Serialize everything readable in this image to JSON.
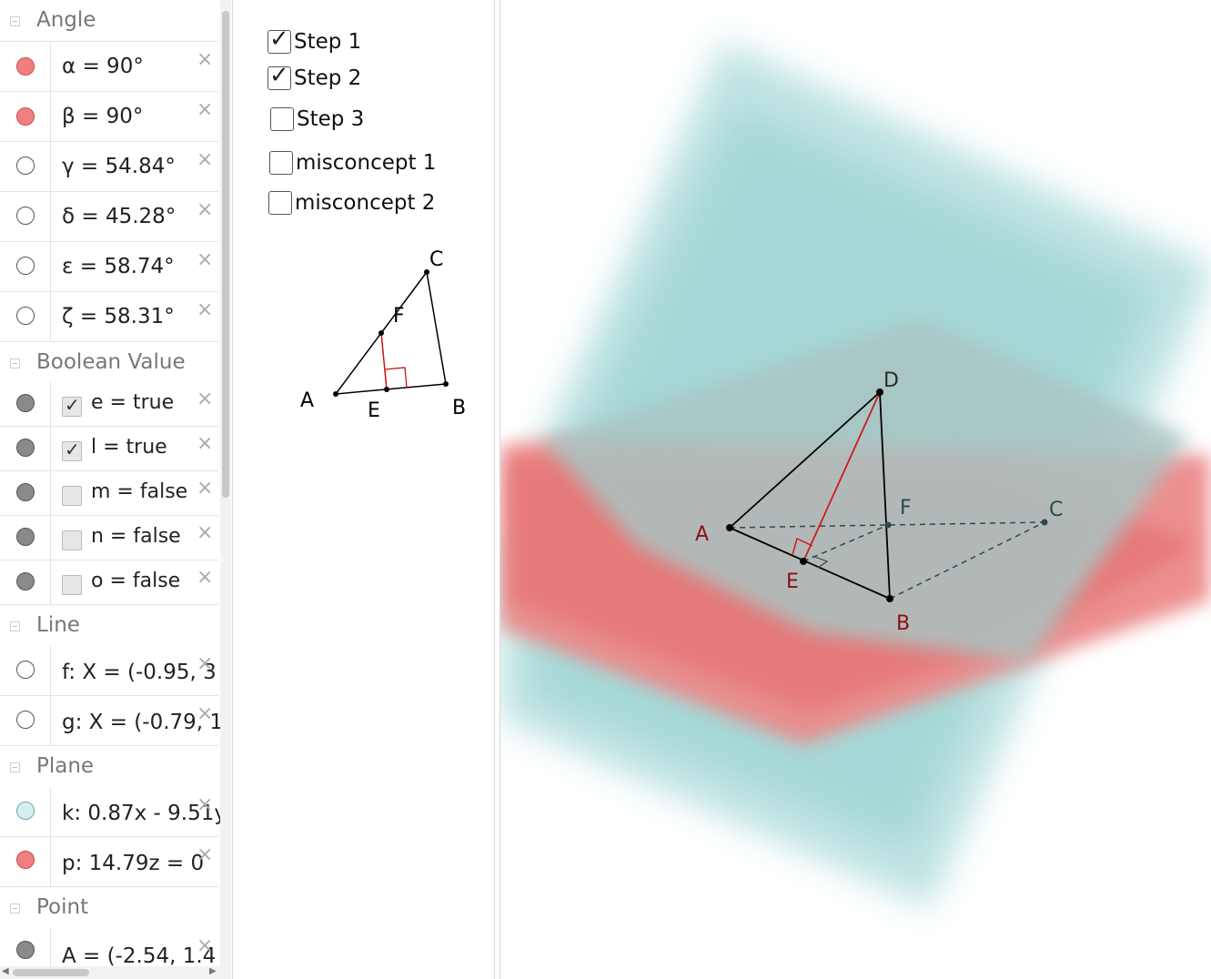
{
  "algebra": {
    "groups": [
      {
        "title": "Angle",
        "rows": [
          {
            "expr": "α = 90°",
            "dot": "red"
          },
          {
            "expr": "β = 90°",
            "dot": "red"
          },
          {
            "expr": "γ = 54.84°",
            "dot": "hidden"
          },
          {
            "expr": "δ = 45.28°",
            "dot": "hidden"
          },
          {
            "expr": "ε = 58.74°",
            "dot": "hidden"
          },
          {
            "expr": "ζ = 58.31°",
            "dot": "hidden"
          }
        ]
      },
      {
        "title": "Boolean Value",
        "rows": [
          {
            "expr": "e = true",
            "dot": "gray",
            "checked": true
          },
          {
            "expr": "l = true",
            "dot": "gray",
            "checked": true
          },
          {
            "expr": "m = false",
            "dot": "gray",
            "checked": false
          },
          {
            "expr": "n = false",
            "dot": "gray",
            "checked": false
          },
          {
            "expr": "o = false",
            "dot": "gray",
            "checked": false
          }
        ]
      },
      {
        "title": "Line",
        "rows": [
          {
            "expr": "f: X = (-0.95, 3",
            "dot": "hidden"
          },
          {
            "expr": "g: X = (-0.79, 1",
            "dot": "hidden"
          }
        ]
      },
      {
        "title": "Plane",
        "rows": [
          {
            "expr": "k: 0.87x - 9.51y",
            "dot": "teal"
          },
          {
            "expr": "p: 14.79z = 0",
            "dot": "red"
          }
        ]
      },
      {
        "title": "Point",
        "rows": [
          {
            "expr": "A = (-2.54, 1.4",
            "dot": "gray"
          }
        ]
      }
    ],
    "close_glyph": "×"
  },
  "graphics2d": {
    "checkboxes": [
      {
        "label": "Step 1",
        "checked": true
      },
      {
        "label": "Step 2",
        "checked": true
      },
      {
        "label": "Step 3",
        "checked": false
      },
      {
        "label": "misconcept 1",
        "checked": false
      },
      {
        "label": "misconcept 2",
        "checked": false
      }
    ],
    "check_glyph": "✓",
    "triangle_labels": {
      "A": "A",
      "B": "B",
      "C": "C",
      "E": "E",
      "F": "F"
    }
  },
  "graphics3d": {
    "point_labels": {
      "A": "A",
      "B": "B",
      "C": "C",
      "D": "D",
      "E": "E",
      "F": "F"
    },
    "colors": {
      "plane_k": "#99d3d1",
      "plane_p": "#e86a6a",
      "altitude": "#d11a1a",
      "edges": "#000000",
      "hidden_edges": "#2b4a48"
    }
  }
}
